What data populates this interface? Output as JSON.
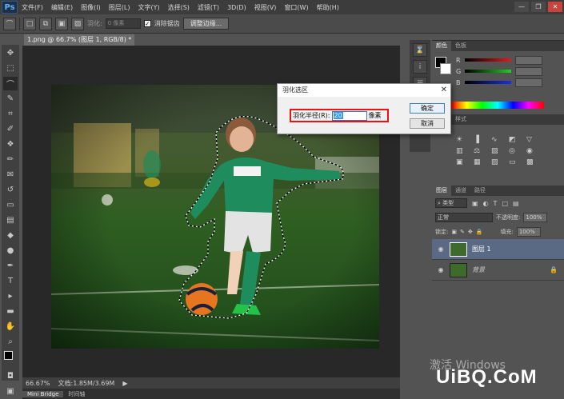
{
  "menubar": {
    "logo": "Ps",
    "items": [
      "文件(F)",
      "编辑(E)",
      "图像(I)",
      "图层(L)",
      "文字(Y)",
      "选择(S)",
      "滤镜(T)",
      "3D(D)",
      "视图(V)",
      "窗口(W)",
      "帮助(H)"
    ],
    "controls": [
      "—",
      "❐",
      "✕"
    ]
  },
  "options": {
    "feather_label": "羽化:",
    "feather_value": "0 像素",
    "antialias_label": "消除锯齿",
    "refine_button": "调整边缘..."
  },
  "document": {
    "tab_title": "1.png @ 66.7% (图层 1, RGB/8) *",
    "tab_close": "×",
    "zoom": "66.67%",
    "doc_info": "文档:1.85M/3.69M",
    "bottom_tabs": [
      "Mini Bridge",
      "时间轴"
    ]
  },
  "panels": {
    "color_tabs": [
      "颜色",
      "色板"
    ],
    "rgb_labels": [
      "R",
      "G",
      "B"
    ],
    "styles_tabs": [
      "调整",
      "样式"
    ],
    "layers_tabs": [
      "图层",
      "通道",
      "路径"
    ],
    "kind_label": "类型",
    "blend_mode": "正常",
    "opacity_label": "不透明度:",
    "opacity_value": "100%",
    "lock_label": "锁定:",
    "fill_label": "填充:",
    "fill_value": "100%",
    "layers": [
      {
        "name": "图层 1"
      },
      {
        "name": "背景"
      }
    ]
  },
  "dialog": {
    "title": "羽化选区",
    "close": "✕",
    "radius_label": "羽化半径(R):",
    "radius_value": "20",
    "unit": "像素",
    "ok": "确定",
    "cancel": "取消"
  },
  "watermark": {
    "activate": "激活 Windows",
    "site": "UiBQ.CoM"
  }
}
